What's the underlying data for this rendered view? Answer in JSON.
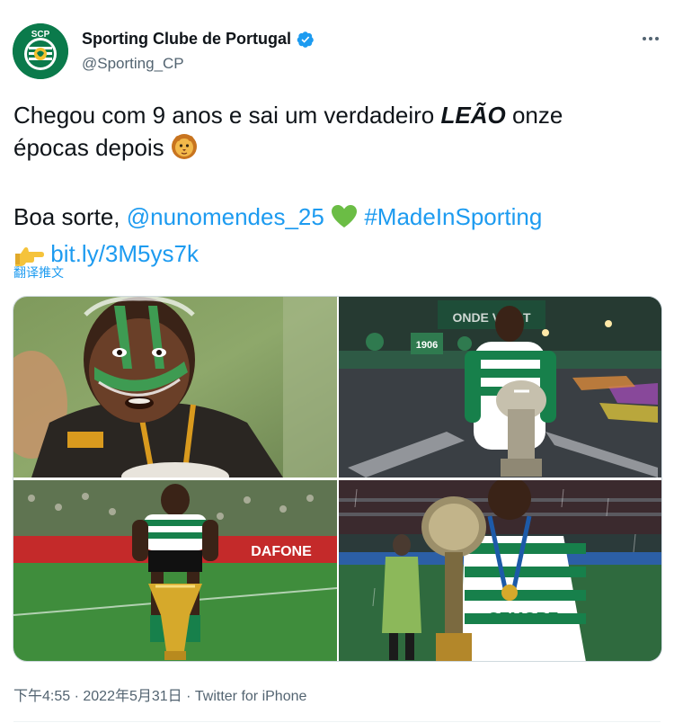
{
  "author": {
    "display_name": "Sporting Clube de Portugal",
    "handle": "@Sporting_CP",
    "avatar_text": "SCP",
    "avatar_ring_text": "SPORTING CLUBE PORTUGAL"
  },
  "tweet": {
    "line1_before": "Chegou com 9 anos e sai um verdadeiro ",
    "line1_bold": "LEÃO",
    "line1_after": " onze",
    "line2": "épocas depois",
    "line3_prefix": "Boa sorte, ",
    "mention": "@nunomendes_25",
    "hashtag": "#MadeInSporting",
    "url": "bit.ly/3M5ys7k",
    "translate_label": "翻译推文"
  },
  "media": {
    "photo2_banner": "ONDE VÃO T",
    "photo2_year": "1906",
    "photo3_sponsor": "DAFONE",
    "photo4_sponsor": "ER BOCK",
    "photo4_shirt": "CEMORE"
  },
  "meta": {
    "time": "下午4:55",
    "date": "2022年5月31日",
    "separator": " · ",
    "source": "Twitter for iPhone"
  },
  "colors": {
    "link": "#1d9bf0",
    "verified": "#1d9bf0",
    "sporting_green": "#0b7a4b",
    "secondary_text": "#536471"
  },
  "icons": {
    "verified": "verified-badge-icon",
    "more": "more-dots-icon",
    "lion": "lion-face-emoji",
    "heart": "green-heart-emoji",
    "pointing": "pointing-right-emoji"
  }
}
